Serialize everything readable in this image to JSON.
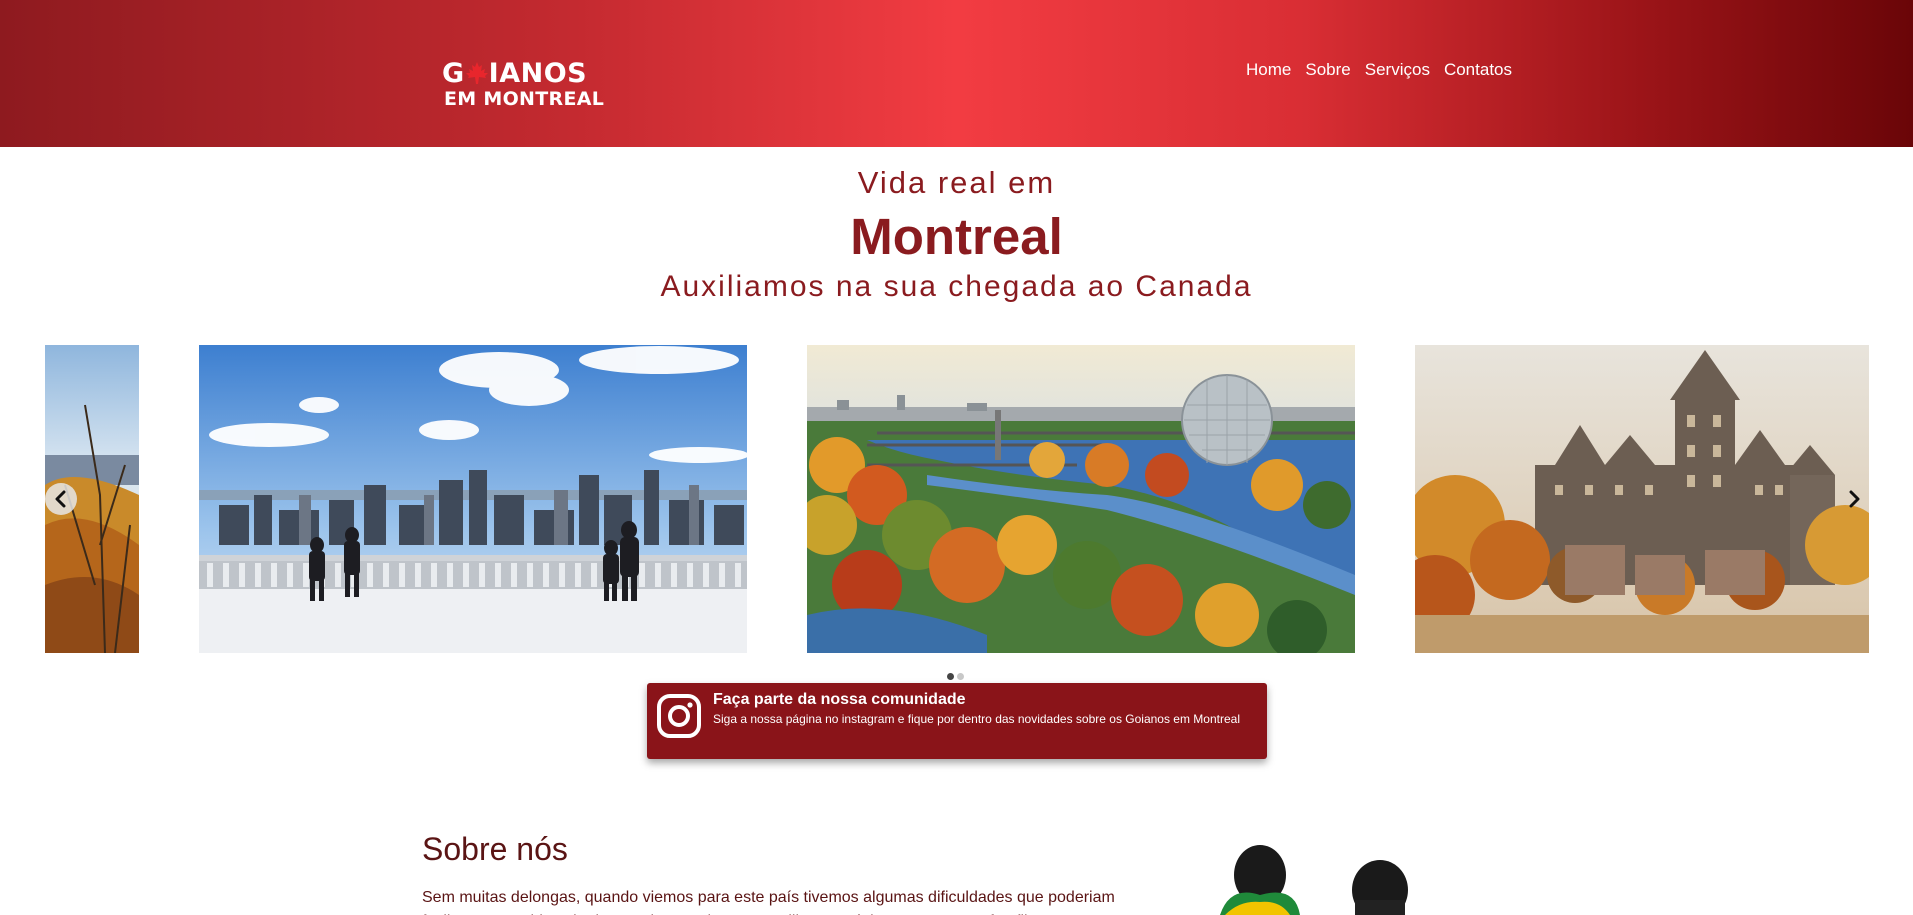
{
  "header": {
    "logo": {
      "line1_left": "G",
      "line1_right": "IANOS",
      "line2": "EM MONTREAL"
    },
    "nav": [
      {
        "label": "Home"
      },
      {
        "label": "Sobre"
      },
      {
        "label": "Serviços"
      },
      {
        "label": "Contatos"
      }
    ]
  },
  "hero": {
    "pre": "Vida real em",
    "title": "Montreal",
    "subtitle": "Auxiliamos na sua chegada ao Canada"
  },
  "carousel": {
    "slides": [
      {
        "name": "autumn-forest"
      },
      {
        "name": "mont-royal-winter-skyline"
      },
      {
        "name": "biosphere-river-autumn"
      },
      {
        "name": "chateau-frontenac-autumn"
      }
    ],
    "dots": 2,
    "active_dot": 0
  },
  "instagram": {
    "title": "Faça parte da nossa comunidade",
    "description": "Siga a nossa página no instagram e fique por dentro das novidades sobre os Goianos em Montreal"
  },
  "about": {
    "title": "Sobre nós",
    "text": "Sem muitas delongas, quando viemos para este país tivemos algumas dificuldades que poderiam facilmente ter sido evitadas. Assim, resolvemos auxiliar os próximos a trazerem famílias"
  },
  "colors": {
    "header_red": "#f23c42",
    "dark_red": "#8a1b1f",
    "text_red": "#5a1414",
    "maple_red": "#e8262c"
  }
}
